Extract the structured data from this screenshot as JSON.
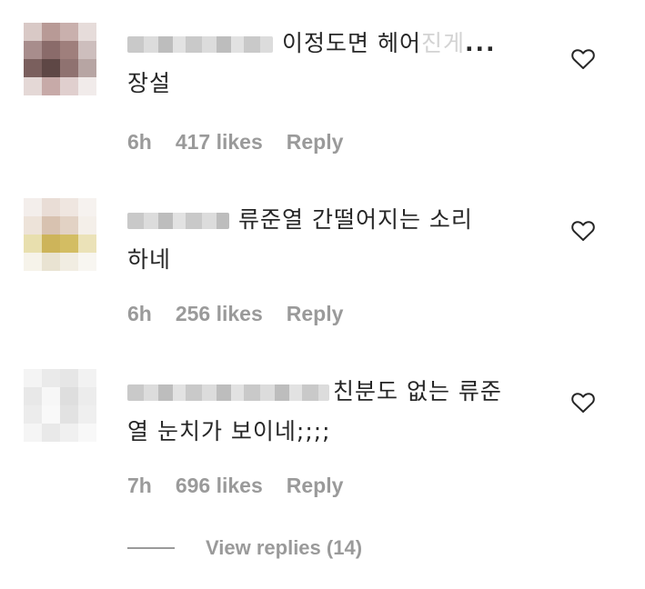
{
  "comments": [
    {
      "text_main": "이정도면 헤어",
      "text_faded": "진게",
      "more": "...",
      "text_line2": "장설",
      "time": "6h",
      "likes": "417 likes",
      "reply": "Reply"
    },
    {
      "text_main": "류준열 간떨어지는 소리",
      "text_line2": "하네",
      "time": "6h",
      "likes": "256 likes",
      "reply": "Reply"
    },
    {
      "text_main": "친분도 없는 류준",
      "text_line2": "열 눈치가 보이네;;;;",
      "time": "7h",
      "likes": "696 likes",
      "reply": "Reply"
    }
  ],
  "view_replies": "View replies (14)",
  "icons": {
    "like": "heart-outline-icon"
  }
}
